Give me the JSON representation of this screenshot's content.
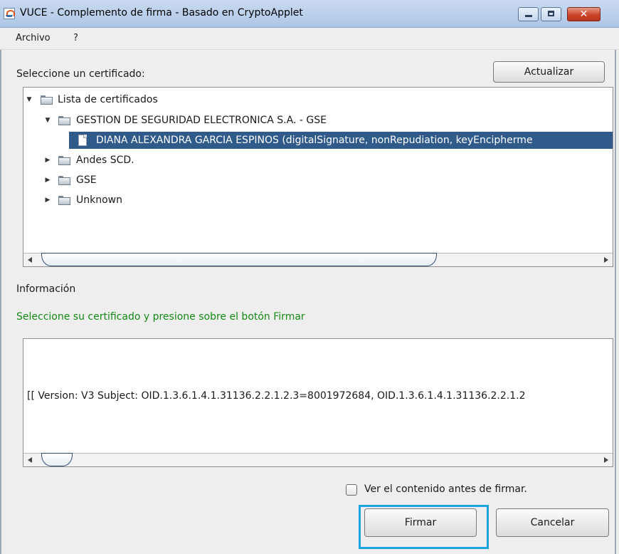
{
  "window": {
    "title": "VUCE - Complemento de firma - Basado en CryptoApplet"
  },
  "menu": {
    "items": [
      "Archivo",
      "?"
    ]
  },
  "select_label": "Seleccione un certificado:",
  "refresh_button": "Actualizar",
  "tree": {
    "root": "Lista de certificados",
    "issuer": "GESTION DE SEGURIDAD ELECTRONICA S.A. - GSE",
    "selected_cert": "DIANA ALEXANDRA GARCIA ESPINOS (digitalSignature, nonRepudiation, keyEncipherme",
    "others": [
      "Andes SCD.",
      "GSE",
      "Unknown"
    ]
  },
  "info": {
    "heading": "Información",
    "instruction": "Seleccione su certificado y presione sobre el botón Firmar",
    "instruction_color": "#148a14",
    "detail": "[[  Version: V3   Subject: OID.1.3.6.1.4.1.31136.2.2.1.2.3=8001972684, OID.1.3.6.1.4.1.31136.2.2.1.2"
  },
  "view_content_checkbox": {
    "label": "Ver el contenido antes de firmar.",
    "checked": false
  },
  "sign_button": "Firmar",
  "cancel_button": "Cancelar"
}
